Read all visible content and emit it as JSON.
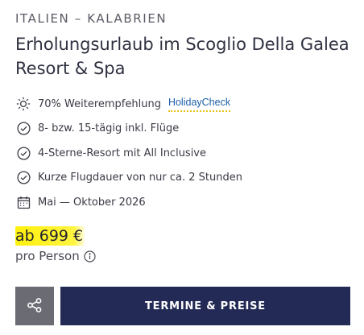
{
  "region": "ITALIEN – KALABRIEN",
  "title": "Erholungsurlaub im Scoglio Della Galea Resort & Spa",
  "features": [
    {
      "icon": "sun-icon",
      "text": "70% Weiterempfehlung",
      "badge": "HolidayCheck"
    },
    {
      "icon": "check-circle-icon",
      "text": "8- bzw. 15-tägig inkl. Flüge"
    },
    {
      "icon": "check-circle-icon",
      "text": "4-Sterne-Resort mit All Inclusive"
    },
    {
      "icon": "check-circle-icon",
      "text": "Kurze Flugdauer von nur ca. 2 Stunden"
    },
    {
      "icon": "calendar-icon",
      "text": "Mai — Oktober 2026"
    }
  ],
  "price": {
    "label": "ab 699 €",
    "sub_label": "pro Person"
  },
  "actions": {
    "share_icon": "share-icon",
    "cta_label": "TERMINE & PREISE"
  },
  "colors": {
    "cta_background": "#232a55",
    "share_background": "#6b6b73",
    "price_highlight": "#fff000",
    "holidaycheck_blue": "#1c5ea8"
  }
}
